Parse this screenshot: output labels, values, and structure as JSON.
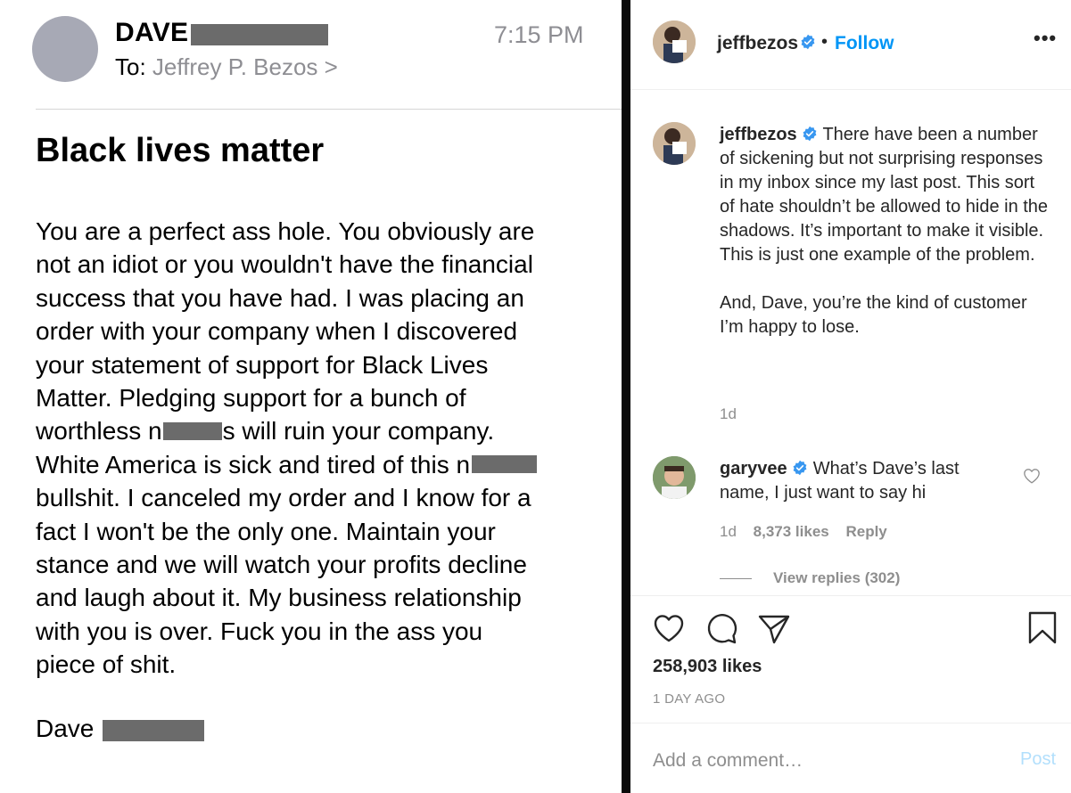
{
  "email": {
    "sender": "DAVE",
    "to_label": "To:",
    "to_name": "Jeffrey P. Bezos",
    "to_chevron": ">",
    "time": "7:15 PM",
    "subject": "Black lives matter",
    "body_lines": [
      [
        "You are a perfect ass hole. You obviously are"
      ],
      [
        "not an idiot or you wouldn't have the financial"
      ],
      [
        "success that you have had. I was placing an"
      ],
      [
        "order with your company when I discovered"
      ],
      [
        "your statement of support for Black Lives"
      ],
      [
        "Matter. Pledging support for a bunch of"
      ],
      [
        "worthless n",
        "s will ruin your company."
      ],
      [
        "White America is sick and tired of this n",
        ""
      ],
      [
        "bullshit. I canceled my order and I know for a"
      ],
      [
        "fact I won't be the only one. Maintain your"
      ],
      [
        "stance and we will watch your profits decline"
      ],
      [
        "and laugh about it. My business relationship"
      ],
      [
        "with you is over. Fuck you in the ass you"
      ],
      [
        "piece of shit."
      ]
    ],
    "signoff": "Dave"
  },
  "instagram": {
    "header": {
      "username": "jeffbezos",
      "dot": "•",
      "follow_label": "Follow",
      "more_label": "•••"
    },
    "caption": {
      "username": "jeffbezos",
      "paragraph1": "There have been a number of sickening but not surprising responses in my inbox since my last post. This sort of hate shouldn’t be allowed to hide in the shadows. It’s important to make it visible. This is just one example of the problem.",
      "paragraph2": "And, Dave, you’re the kind of customer I’m happy to lose.",
      "time": "1d"
    },
    "comment": {
      "username": "garyvee",
      "text": "What’s Dave’s last name, I just want to say hi",
      "time": "1d",
      "likes": "8,373 likes",
      "reply_label": "Reply",
      "view_replies": "View replies (302)"
    },
    "likes": "258,903 likes",
    "date": "1 DAY AGO",
    "add_comment_placeholder": "Add a comment…",
    "post_label": "Post",
    "colors": {
      "link_blue": "#0095f6",
      "verified_blue": "#3897f0",
      "muted_gray": "#8e8e8e",
      "post_disabled": "#b2dffc"
    }
  }
}
